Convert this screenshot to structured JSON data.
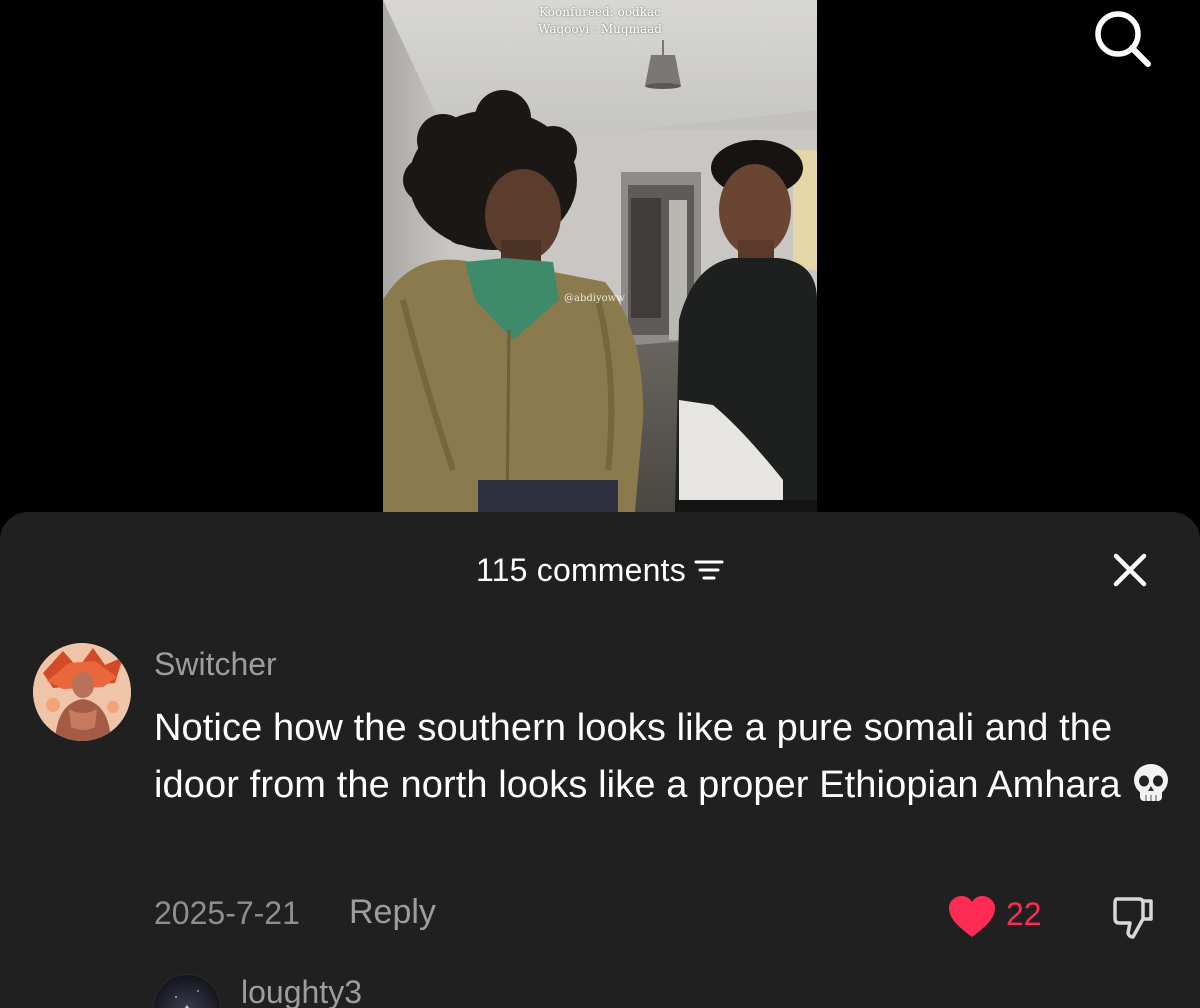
{
  "video": {
    "caption_line1": "Koonfureed: oodkac",
    "caption_line2": "Waqooyi : Muqmaad",
    "watermark": "@abdiyoww"
  },
  "header": {
    "search_icon": "search-icon"
  },
  "comments_sheet": {
    "title": "115 comments",
    "filter_icon": "filter-icon",
    "close_icon": "close-icon"
  },
  "comments": [
    {
      "username": "Switcher",
      "text": "Notice how the southern looks like a pure somali and the idoor from the north looks like a proper Ethiopian Amhara",
      "emoji": "💀",
      "date": "2025-7-21",
      "reply_label": "Reply",
      "likes": "22",
      "like_icon": "heart-icon",
      "dislike_icon": "thumbs-down-icon"
    },
    {
      "username": "loughty3"
    }
  ],
  "colors": {
    "sheet_background": "#202020",
    "like_red": "#fe2c55",
    "muted_text": "#9d9d9d"
  }
}
